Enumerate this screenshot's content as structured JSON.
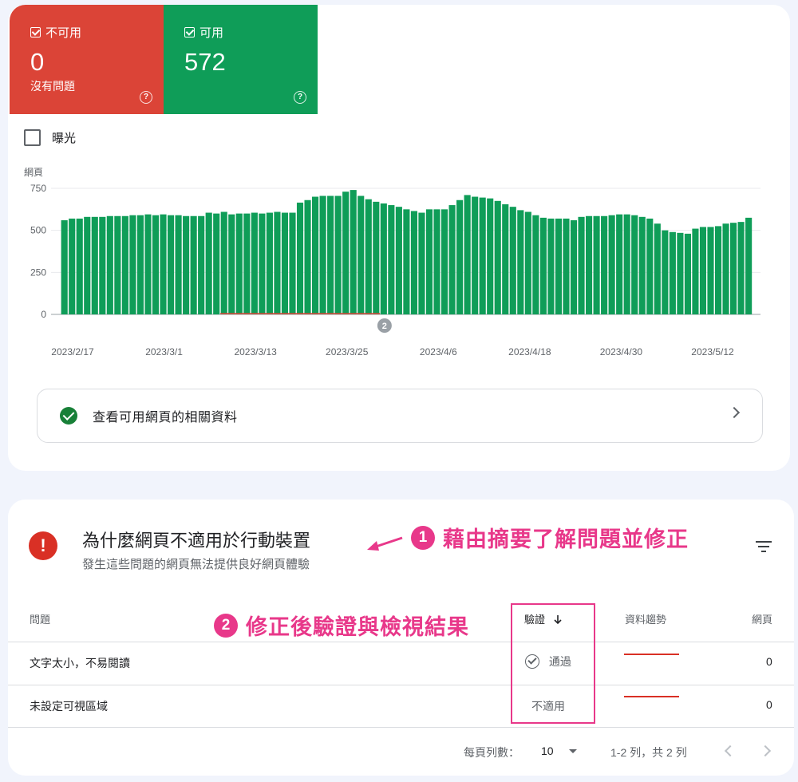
{
  "summary": {
    "not_usable": {
      "label": "不可用",
      "count": "0",
      "subtitle": "沒有問題"
    },
    "usable": {
      "label": "可用",
      "count": "572"
    },
    "help_icon": "help-circle-icon"
  },
  "exposure": {
    "label": "曝光",
    "checked": false
  },
  "chart_data": {
    "type": "bar",
    "ylabel": "網頁",
    "ylim": [
      0,
      750
    ],
    "yticks": [
      "0",
      "250",
      "500",
      "750"
    ],
    "x_tick_labels": [
      "2023/2/17",
      "2023/3/1",
      "2023/3/13",
      "2023/3/25",
      "2023/4/6",
      "2023/4/18",
      "2023/4/30",
      "2023/5/12"
    ],
    "annotation_marker": "2",
    "grid": true,
    "colors": {
      "usable": "#0f9d58",
      "not_usable": "#db4437"
    },
    "values": [
      560,
      570,
      570,
      580,
      580,
      580,
      585,
      585,
      585,
      590,
      590,
      595,
      590,
      595,
      590,
      590,
      585,
      585,
      585,
      605,
      600,
      610,
      595,
      600,
      600,
      605,
      600,
      605,
      610,
      605,
      605,
      665,
      680,
      700,
      705,
      705,
      705,
      730,
      740,
      705,
      685,
      670,
      660,
      650,
      640,
      625,
      615,
      605,
      625,
      625,
      625,
      650,
      680,
      710,
      700,
      695,
      690,
      675,
      655,
      640,
      620,
      610,
      590,
      575,
      570,
      570,
      570,
      560,
      580,
      585,
      585,
      585,
      590,
      595,
      595,
      590,
      580,
      570,
      540,
      500,
      490,
      485,
      480,
      510,
      520,
      520,
      525,
      540,
      545,
      550,
      575
    ]
  },
  "info_link": {
    "text": "查看可用網頁的相關資料"
  },
  "issues_section": {
    "title": "為什麼網頁不適用於行動裝置",
    "subtitle": "發生這些問題的網頁無法提供良好網頁體驗",
    "columns": {
      "issue": "問題",
      "validation": "驗證",
      "trend": "資料趨勢",
      "pages": "網頁"
    },
    "rows": [
      {
        "issue": "文字太小，不易閱讀",
        "validation": "通過",
        "pages": "0"
      },
      {
        "issue": "未設定可視區域",
        "validation": "不適用",
        "pages": "0"
      }
    ],
    "pagination": {
      "rows_per_page_label": "每頁列數：",
      "rows_per_page": "10",
      "range": "1-2 列，共 2 列"
    }
  },
  "annotations": {
    "a1": {
      "number": "1",
      "text": "藉由摘要了解問題並修正"
    },
    "a2": {
      "number": "2",
      "text": "修正後驗證與檢視結果"
    },
    "color": "#e8388a"
  }
}
